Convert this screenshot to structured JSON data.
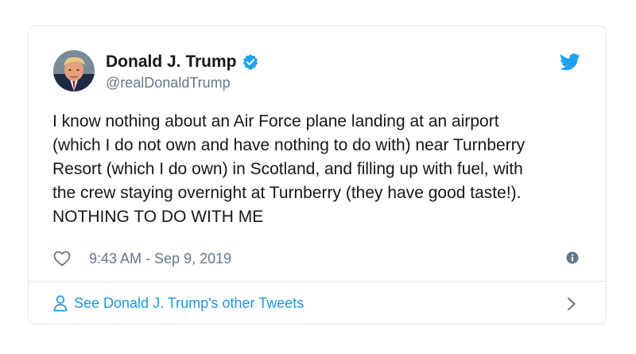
{
  "author": {
    "name": "Donald J. Trump",
    "handle": "@realDonaldTrump",
    "verified": true
  },
  "tweet": {
    "lines": [
      "I know nothing about an Air Force plane landing at an airport",
      "(which I do not own and have nothing to do with) near Turnberry",
      "Resort (which I do own) in Scotland, and filling up with fuel, with",
      "the crew staying overnight at Turnberry (they have good taste!).",
      "NOTHING TO DO WITH ME"
    ],
    "timestamp": "9:43 AM - Sep 9, 2019"
  },
  "footer": {
    "other_tweets_label": "See Donald J. Trump's other Tweets"
  },
  "icons": {
    "twitter": "twitter-bird-icon",
    "verified": "verified-badge-icon",
    "like": "heart-icon",
    "info": "info-icon",
    "person": "person-icon",
    "chevron": "chevron-right-icon"
  },
  "colors": {
    "brand_blue": "#1da1f2",
    "link_blue": "#1b95e0",
    "text": "#14171a",
    "muted": "#657786",
    "border": "#e1e8ed"
  }
}
